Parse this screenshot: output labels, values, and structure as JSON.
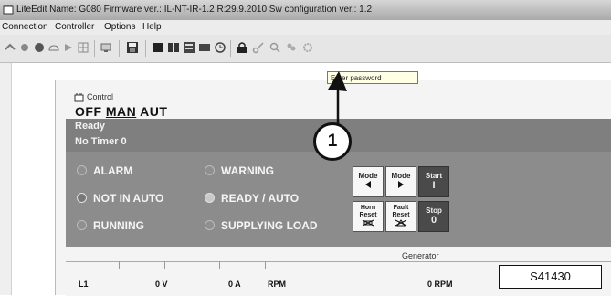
{
  "window": {
    "title": "LiteEdit Name: G080 Firmware ver.: IL-NT-IR-1.2 R:29.9.2010 Sw configuration ver.: 1.2"
  },
  "menu": {
    "items": [
      "Connection",
      "Controller",
      "Options",
      "Help"
    ]
  },
  "toolbar": {
    "tooltip": "Enter password",
    "icons": [
      "connect-icon",
      "disconnect-icon",
      "record-icon",
      "cloud-icon",
      "forward-icon",
      "grid-icon",
      "display-icon",
      "save-icon",
      "control-icon",
      "configuration-icon",
      "values-icon",
      "history-icon",
      "clock-icon",
      "lock-icon",
      "key-icon",
      "search-icon",
      "users-icon",
      "settings-icon"
    ]
  },
  "control": {
    "window_title": "Control",
    "modes": [
      "OFF",
      "MAN",
      "AUT"
    ],
    "active_mode": "MAN",
    "status_line1": "Ready",
    "status_line2": "No Timer 0",
    "indicators": [
      "ALARM",
      "WARNING",
      "NOT IN AUTO",
      "READY / AUTO",
      "RUNNING",
      "SUPPLYING LOAD"
    ],
    "buttons": {
      "mode_left": "Mode",
      "mode_right": "Mode",
      "start": "Start",
      "horn_reset": "Horn Reset",
      "fault_reset": "Fault Reset",
      "stop": "Stop",
      "stop_value": "0",
      "start_value": "I"
    },
    "generator": {
      "section_label": "Generator",
      "row": {
        "label": "L1",
        "voltage": "0 V",
        "current": "0 A",
        "rpm_label": "RPM",
        "rpm_value": "0 RPM"
      }
    }
  },
  "annotation": {
    "callout_number": "1",
    "figure_id": "S41430"
  },
  "colors": {
    "status_bg": "#7f7f7f",
    "panel_bg": "#8c8c8c",
    "tooltip_bg": "#ffffe6"
  }
}
